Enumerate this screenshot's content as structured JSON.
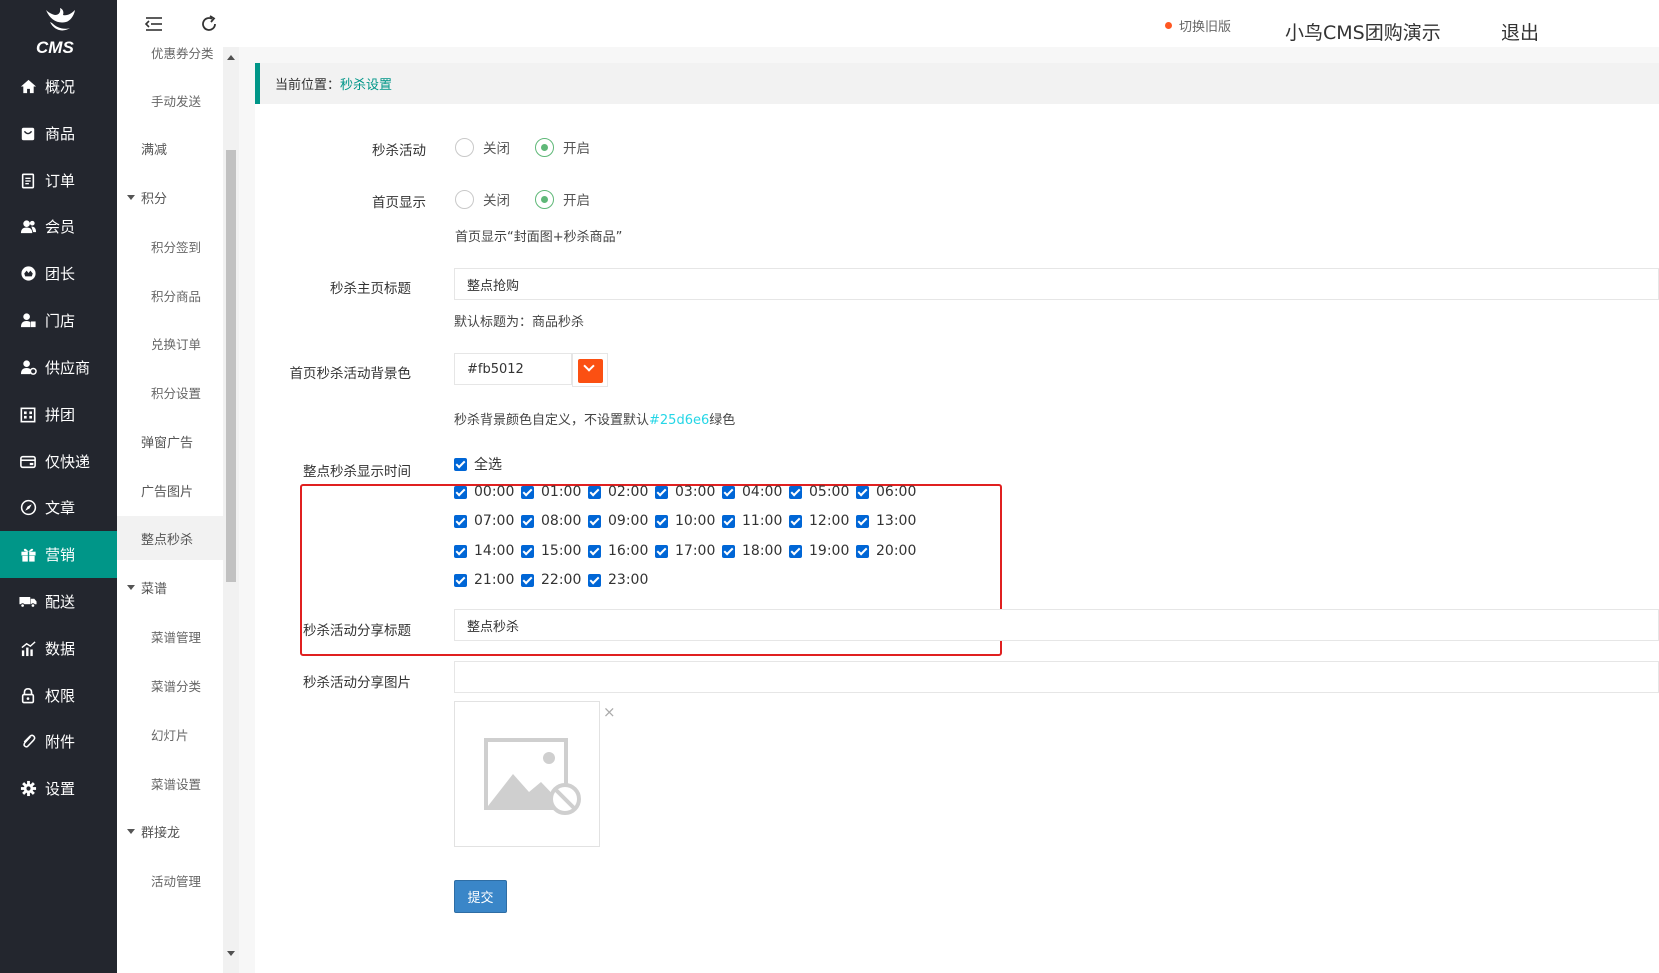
{
  "logo": {
    "text": "CMS"
  },
  "sidebar": {
    "items": [
      {
        "label": "概况",
        "icon": "home-icon"
      },
      {
        "label": "商品",
        "icon": "product-icon"
      },
      {
        "label": "订单",
        "icon": "order-icon"
      },
      {
        "label": "会员",
        "icon": "member-icon"
      },
      {
        "label": "团长",
        "icon": "leader-icon"
      },
      {
        "label": "门店",
        "icon": "store-icon"
      },
      {
        "label": "供应商",
        "icon": "supplier-icon"
      },
      {
        "label": "拼团",
        "icon": "group-buy-icon"
      },
      {
        "label": "仅快递",
        "icon": "express-icon"
      },
      {
        "label": "文章",
        "icon": "article-icon"
      },
      {
        "label": "营销",
        "icon": "gift-icon",
        "active": true
      },
      {
        "label": "配送",
        "icon": "truck-icon"
      },
      {
        "label": "数据",
        "icon": "chart-icon"
      },
      {
        "label": "权限",
        "icon": "lock-icon"
      },
      {
        "label": "附件",
        "icon": "attachment-icon"
      },
      {
        "label": "设置",
        "icon": "gear-icon"
      }
    ]
  },
  "subnav": {
    "items": [
      {
        "label": "优惠券分类",
        "level": 2
      },
      {
        "label": "手动发送",
        "level": 2
      },
      {
        "label": "满减",
        "level": 1
      },
      {
        "label": "积分",
        "level": 0
      },
      {
        "label": "积分签到",
        "level": 2
      },
      {
        "label": "积分商品",
        "level": 2
      },
      {
        "label": "兑换订单",
        "level": 2
      },
      {
        "label": "积分设置",
        "level": 2
      },
      {
        "label": "弹窗广告",
        "level": 1
      },
      {
        "label": "广告图片",
        "level": 1
      },
      {
        "label": "整点秒杀",
        "level": 1,
        "selected": true
      },
      {
        "label": "菜谱",
        "level": 0
      },
      {
        "label": "菜谱管理",
        "level": 2
      },
      {
        "label": "菜谱分类",
        "level": 2
      },
      {
        "label": "幻灯片",
        "level": 2
      },
      {
        "label": "菜谱设置",
        "level": 2
      },
      {
        "label": "群接龙",
        "level": 0
      },
      {
        "label": "活动管理",
        "level": 2
      }
    ]
  },
  "header": {
    "old_version": "切换旧版",
    "site_name": "小鸟CMS团购演示",
    "logout": "退出"
  },
  "breadcrumb": {
    "prefix": "当前位置：",
    "current": "秒杀设置"
  },
  "form": {
    "seckill_activity": {
      "label": "秒杀活动",
      "options": [
        "关闭",
        "开启"
      ],
      "selected": "开启"
    },
    "home_display": {
      "label": "首页显示",
      "options": [
        "关闭",
        "开启"
      ],
      "selected": "开启",
      "hint": "首页显示“封面图+秒杀商品”"
    },
    "home_title": {
      "label": "秒杀主页标题",
      "value": "整点抢购",
      "hint": "默认标题为：商品秒杀"
    },
    "bg_color": {
      "label": "首页秒杀活动背景色",
      "value": "#fb5012",
      "swatch": "#fb5012",
      "hint_prefix": "秒杀背景颜色自定义，不设置默认",
      "hint_color": "#25d6e6",
      "hint_suffix": "绿色"
    },
    "display_time": {
      "label": "整点秒杀显示时间",
      "select_all": "全选",
      "times": [
        "00:00",
        "01:00",
        "02:00",
        "03:00",
        "04:00",
        "05:00",
        "06:00",
        "07:00",
        "08:00",
        "09:00",
        "10:00",
        "11:00",
        "12:00",
        "13:00",
        "14:00",
        "15:00",
        "16:00",
        "17:00",
        "18:00",
        "19:00",
        "20:00",
        "21:00",
        "22:00",
        "23:00"
      ]
    },
    "share_title": {
      "label": "秒杀活动分享标题",
      "value": "整点秒杀"
    },
    "share_image": {
      "label": "秒杀活动分享图片",
      "value": "",
      "remove": "×"
    },
    "submit": "提交"
  }
}
